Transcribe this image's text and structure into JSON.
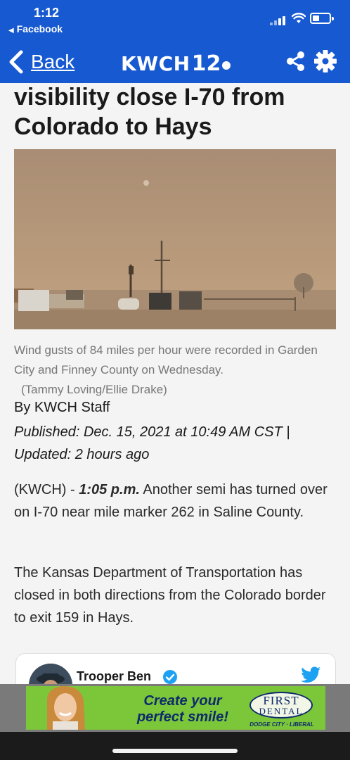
{
  "status": {
    "time": "1:12",
    "back_app": "Facebook"
  },
  "nav": {
    "back_label": "Back",
    "logo_text": "KWCH",
    "logo_number": "12"
  },
  "article": {
    "headline": "visibility close I-70 from Colorado to Hays",
    "caption": "Wind gusts of 84 miles per hour were recorded in Garden City and Finney County on Wednesday.",
    "credit": "(Tammy Loving/Ellie Drake)",
    "byline": "By KWCH Staff",
    "published": "Published: Dec. 15, 2021 at 10:49 AM CST | Updated: 2 hours ago",
    "para1_lead": "(KWCH) - ",
    "para1_time": "1:05 p.m.",
    "para1_text": " Another semi has turned over on I-70 near mile marker 262 in Saline County.",
    "para2": "The Kansas Department of Transportation has closed in both directions from the Colorado border to exit 159 in Hays."
  },
  "tweet": {
    "author": "Trooper Ben"
  },
  "ad": {
    "slogan": "Create your perfect smile!",
    "brand_line1": "FIRST",
    "brand_line2": "DENTAL",
    "brand_sub": "DODGE CITY · LIBERAL"
  },
  "colors": {
    "nav_blue": "#1759d1",
    "ad_green": "#7cc63a",
    "ad_navy": "#0d2a6b",
    "twitter_blue": "#1da1f2"
  }
}
